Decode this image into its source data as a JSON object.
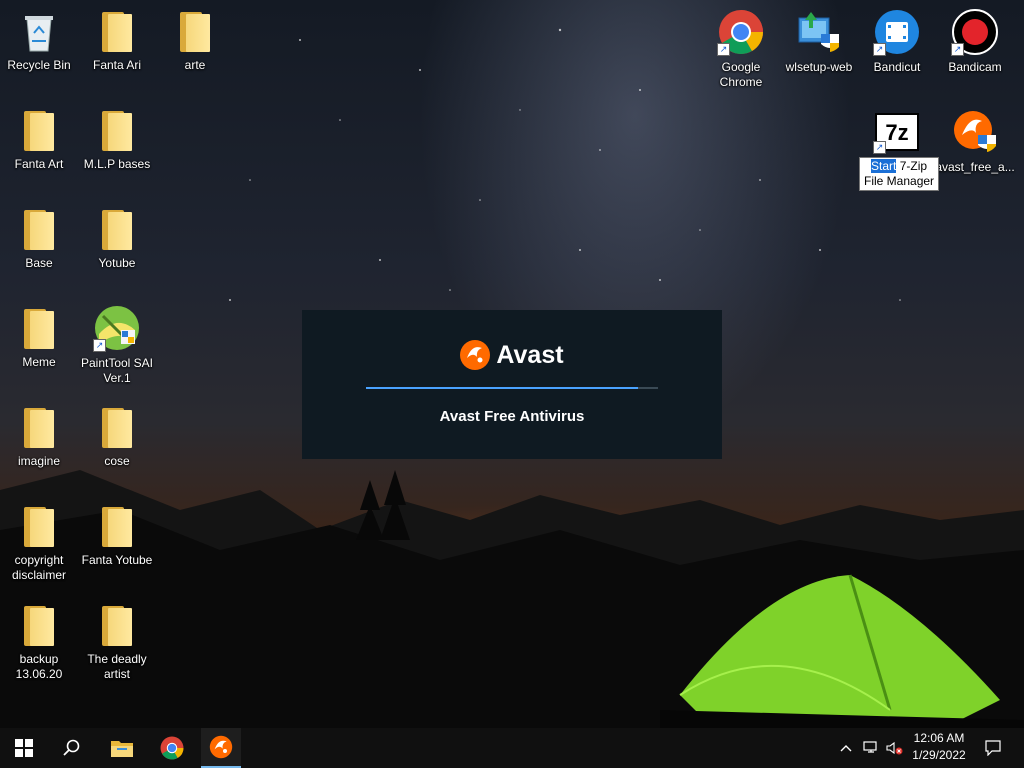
{
  "desktop": {
    "left_icons": [
      {
        "label": "Recycle Bin",
        "icon": "recycle-bin-icon"
      },
      {
        "label": "Fanta Ari",
        "icon": "folder-icon"
      },
      {
        "label": "arte",
        "icon": "folder-icon"
      },
      {
        "label": "Fanta Art",
        "icon": "folder-icon"
      },
      {
        "label": "M.L.P bases",
        "icon": "folder-icon"
      },
      {
        "label": "Base",
        "icon": "folder-icon"
      },
      {
        "label": "Yotube",
        "icon": "folder-icon"
      },
      {
        "label": "Meme",
        "icon": "folder-icon"
      },
      {
        "label": "PaintTool SAI Ver.1",
        "icon": "painttool-sai-icon"
      },
      {
        "label": "imagine",
        "icon": "folder-icon"
      },
      {
        "label": "cose",
        "icon": "folder-icon"
      },
      {
        "label": "copyright disclaimer",
        "icon": "folder-icon"
      },
      {
        "label": "Fanta Yotube",
        "icon": "folder-icon"
      },
      {
        "label": "backup 13.06.20",
        "icon": "folder-icon"
      },
      {
        "label": "The deadly artist",
        "icon": "folder-icon"
      }
    ],
    "right_icons": [
      {
        "label": "Google Chrome",
        "icon": "chrome-icon"
      },
      {
        "label": "wlsetup-web",
        "icon": "wlsetup-icon"
      },
      {
        "label": "Bandicut",
        "icon": "bandicut-icon"
      },
      {
        "label": "Bandicam",
        "icon": "bandicam-icon"
      },
      {
        "label": "7-Zip File Manager",
        "icon": "7zip-icon"
      },
      {
        "label": "avast_free_a...",
        "icon": "avast-installer-icon"
      }
    ],
    "seven_zip_glyph": "7z"
  },
  "rename_tooltip": {
    "selected_text": "Start",
    "line1_rest": "7-Zip",
    "line2": "File Manager"
  },
  "splash": {
    "brand": "Avast",
    "product": "Avast Free Antivirus",
    "progress": 0.93,
    "accent": "#ff6a00"
  },
  "taskbar": {
    "start": "windows-start-icon",
    "search": "search-icon",
    "pinned": [
      "file-explorer-icon",
      "chrome-icon",
      "avast-icon"
    ],
    "tray": {
      "icons": [
        "chevron-up-icon",
        "network-icon",
        "volume-muted-icon"
      ],
      "time": "12:06 AM",
      "date": "1/29/2022",
      "notifications": "notification-icon"
    }
  }
}
